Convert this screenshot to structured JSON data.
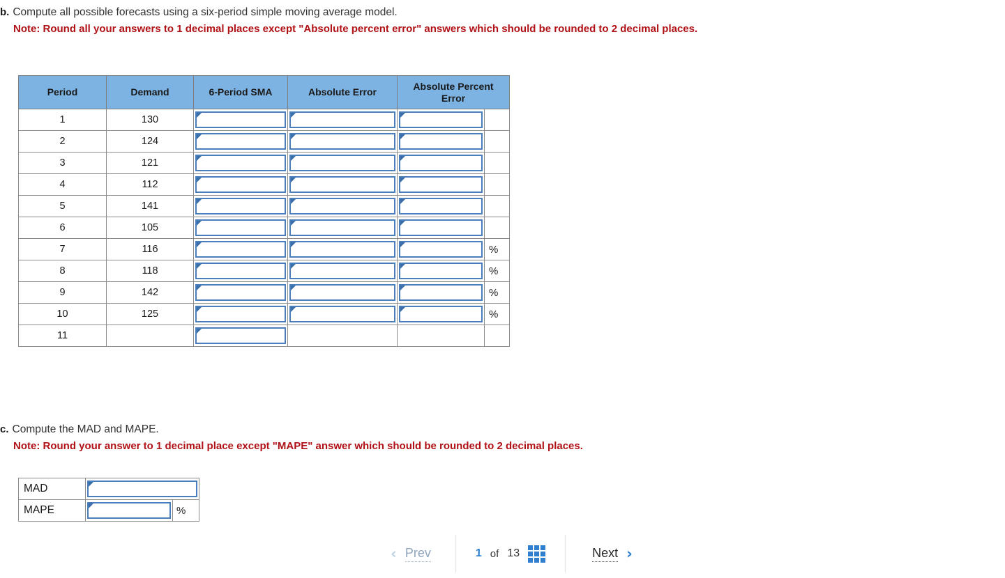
{
  "question_b": {
    "marker": "b.",
    "text": "Compute all possible forecasts using a six-period simple moving average model.",
    "note": "Note: Round all your answers to 1 decimal places except \"Absolute percent error\" answers which should be rounded to 2 decimal places."
  },
  "question_c": {
    "marker": "c.",
    "text": "Compute the MAD and MAPE.",
    "note": "Note: Round your answer to 1 decimal place except \"MAPE\" answer which should be rounded to 2 decimal places."
  },
  "table": {
    "headers": [
      "Period",
      "Demand",
      "6-Period SMA",
      "Absolute Error",
      "Absolute Percent Error"
    ],
    "rows": [
      {
        "period": "1",
        "demand": "130",
        "sma_input": "",
        "abserr_input": "",
        "ape_input": "",
        "pct": ""
      },
      {
        "period": "2",
        "demand": "124",
        "sma_input": "",
        "abserr_input": "",
        "ape_input": "",
        "pct": ""
      },
      {
        "period": "3",
        "demand": "121",
        "sma_input": "",
        "abserr_input": "",
        "ape_input": "",
        "pct": ""
      },
      {
        "period": "4",
        "demand": "112",
        "sma_input": "",
        "abserr_input": "",
        "ape_input": "",
        "pct": ""
      },
      {
        "period": "5",
        "demand": "141",
        "sma_input": "",
        "abserr_input": "",
        "ape_input": "",
        "pct": ""
      },
      {
        "period": "6",
        "demand": "105",
        "sma_input": "",
        "abserr_input": "",
        "ape_input": "",
        "pct": ""
      },
      {
        "period": "7",
        "demand": "116",
        "sma_input": "",
        "abserr_input": "",
        "ape_input": "",
        "pct": "%"
      },
      {
        "period": "8",
        "demand": "118",
        "sma_input": "",
        "abserr_input": "",
        "ape_input": "",
        "pct": "%"
      },
      {
        "period": "9",
        "demand": "142",
        "sma_input": "",
        "abserr_input": "",
        "ape_input": "",
        "pct": "%"
      },
      {
        "period": "10",
        "demand": "125",
        "sma_input": "",
        "abserr_input": "",
        "ape_input": "",
        "pct": "%"
      },
      {
        "period": "11",
        "demand": "",
        "sma_input": "",
        "abserr_input": null,
        "ape_input": null,
        "pct": ""
      }
    ]
  },
  "summary": {
    "mad_label": "MAD",
    "mad_value": "",
    "mape_label": "MAPE",
    "mape_value": "",
    "mape_pct": "%"
  },
  "nav": {
    "prev_label": "Prev",
    "prev_chevron": "‹",
    "current_page": "1",
    "of_label": "of",
    "total_pages": "13",
    "grid_icon": "grid-icon",
    "next_label": "Next",
    "next_chevron": "›"
  },
  "colors": {
    "header_blue": "#7cb3e3",
    "input_border": "#4a7ebb",
    "note_red": "#b01116",
    "accent_blue": "#2f7fd0"
  }
}
